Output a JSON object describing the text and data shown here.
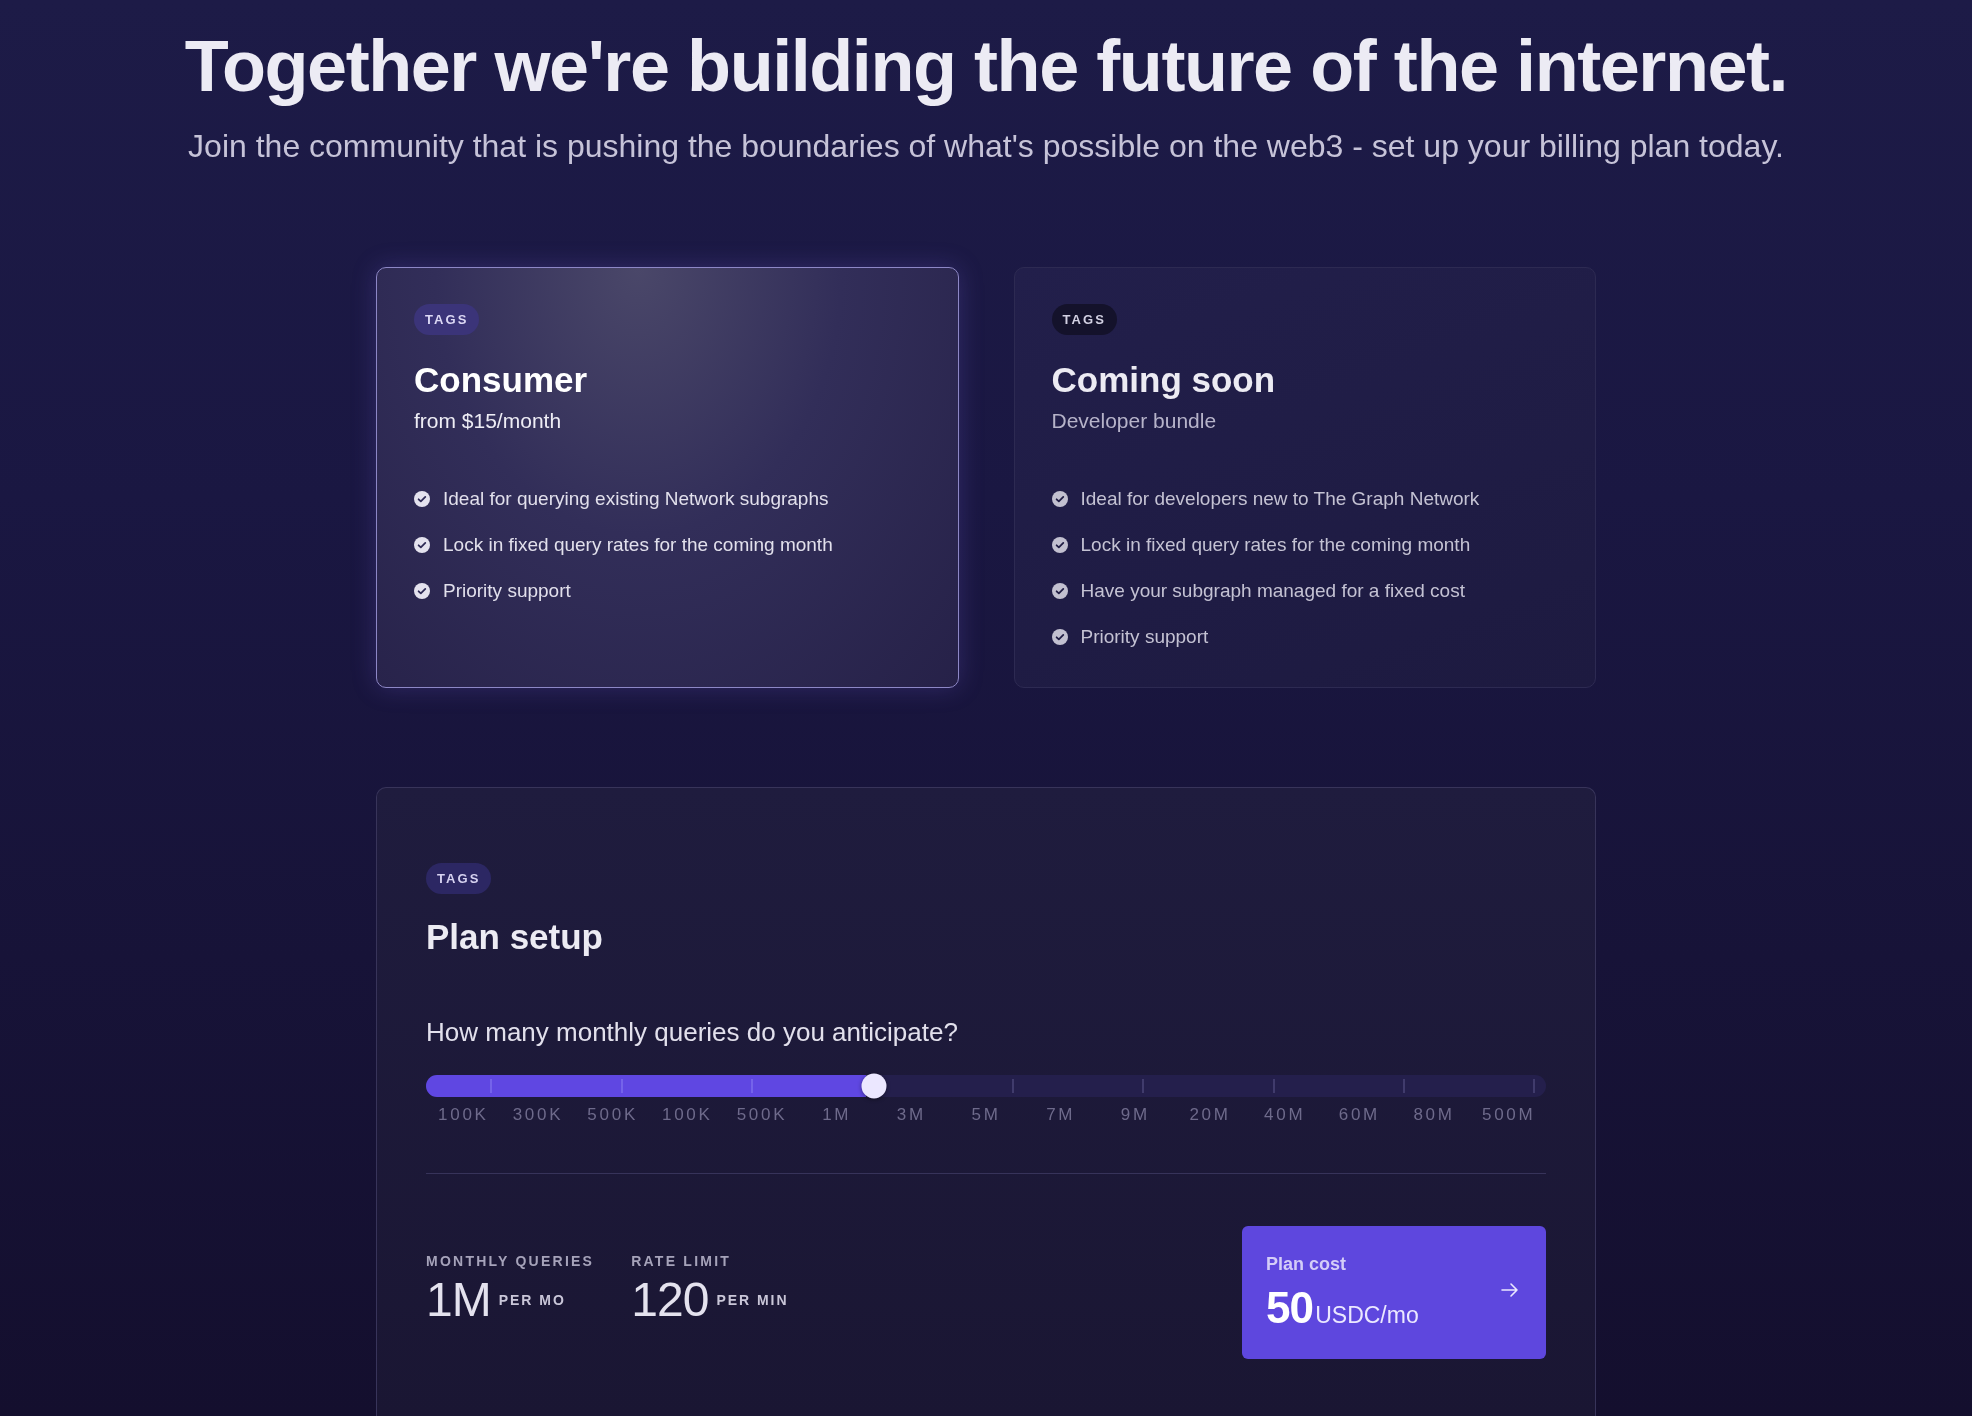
{
  "header": {
    "title": "Together we're building the future of the internet.",
    "subtitle": "Join the community that is pushing the boundaries of what's possible on the web3 - set up your billing plan today."
  },
  "plans": [
    {
      "tag": "TAGS",
      "title": "Consumer",
      "subtitle": "from $15/month",
      "selected": true,
      "features": [
        "Ideal for querying existing Network subgraphs",
        "Lock in fixed query rates for the coming month",
        "Priority support"
      ]
    },
    {
      "tag": "TAGS",
      "title": "Coming soon",
      "subtitle": "Developer bundle",
      "selected": false,
      "features": [
        "Ideal for developers new to The Graph Network",
        "Lock in fixed query rates for the coming month",
        "Have your subgraph managed for a fixed cost",
        "Priority support"
      ]
    }
  ],
  "plan_setup": {
    "tag": "TAGS",
    "title": "Plan setup",
    "question": "How many monthly queries do you anticipate?",
    "slider": {
      "level": 0.4,
      "ticks": [
        "100K",
        "300K",
        "500K",
        "100K",
        "500K",
        "1M",
        "3M",
        "5M",
        "7M",
        "9M",
        "20M",
        "40M",
        "60M",
        "80M",
        "500M"
      ]
    },
    "stats": [
      {
        "label": "MONTHLY QUERIES",
        "value": "1M",
        "unit": "PER MO"
      },
      {
        "label": "RATE LIMIT",
        "value": "120",
        "unit": "PER MIN"
      }
    ],
    "cost_button": {
      "label": "Plan cost",
      "amount": "50",
      "unit": "USDC/mo"
    }
  }
}
